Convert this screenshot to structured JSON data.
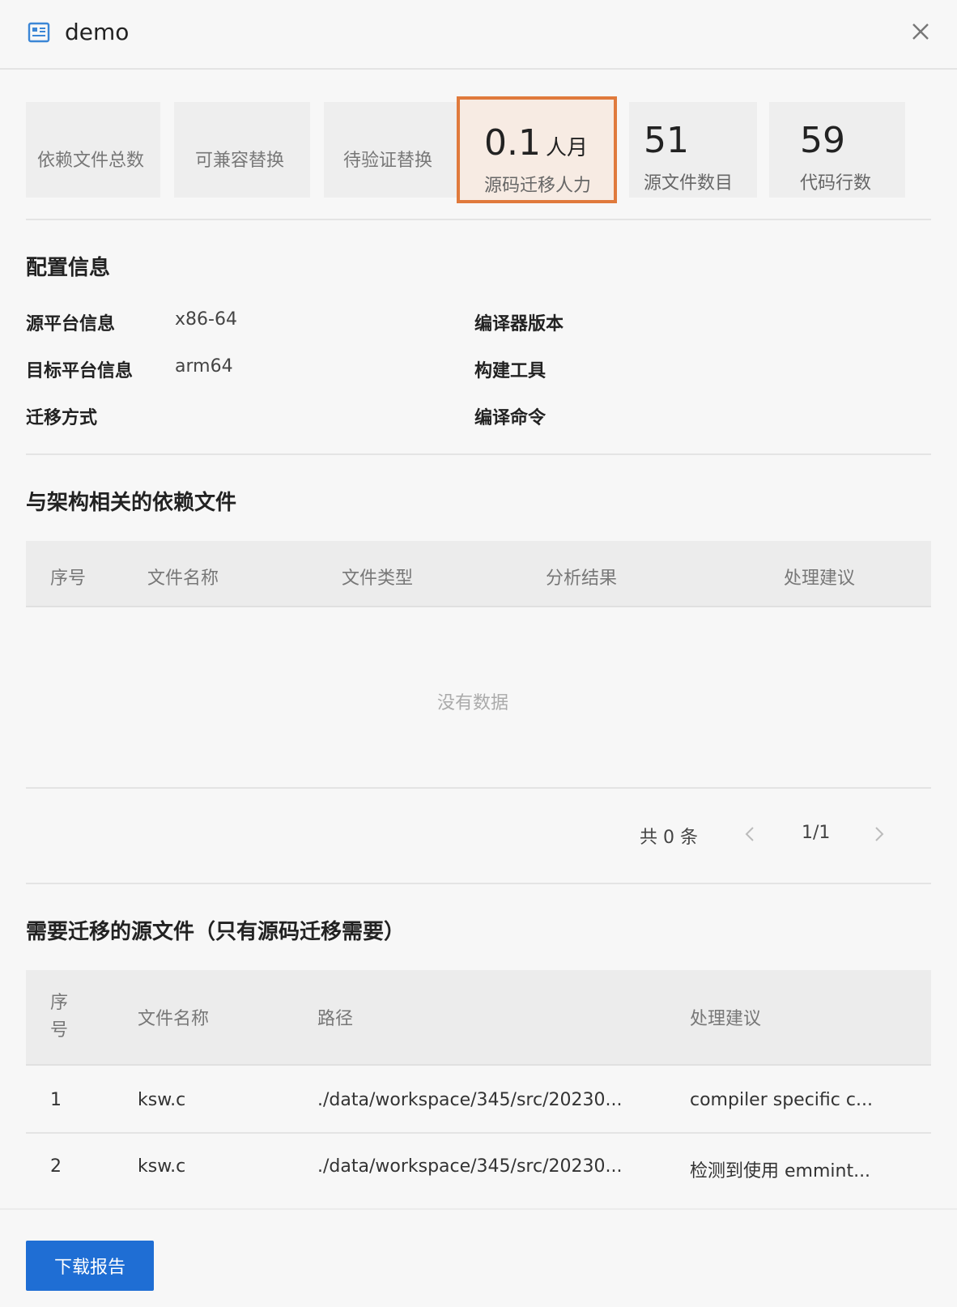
{
  "header": {
    "title": "demo"
  },
  "cards": {
    "dep_total": "依赖文件总数",
    "compatible": "可兼容替换",
    "pending": "待验证替换",
    "effort": {
      "value": "0.1",
      "unit": "人月",
      "label": "源码迁移人力"
    },
    "source_files": {
      "value": "51",
      "label": "源文件数目"
    },
    "code_lines": {
      "value": "59",
      "label": "代码行数"
    }
  },
  "config": {
    "title": "配置信息",
    "source_platform_label": "源平台信息",
    "source_platform_value": "x86-64",
    "target_platform_label": "目标平台信息",
    "target_platform_value": "arm64",
    "migration_mode_label": "迁移方式",
    "compiler_version_label": "编译器版本",
    "build_tool_label": "构建工具",
    "compile_cmd_label": "编译命令"
  },
  "deps": {
    "title": "与架构相关的依赖文件",
    "columns": [
      "序号",
      "文件名称",
      "文件类型",
      "分析结果",
      "处理建议"
    ],
    "empty_text": "没有数据",
    "pager": {
      "total": "共 0 条",
      "page": "1/1"
    }
  },
  "sources": {
    "title": "需要迁移的源文件（只有源码迁移需要）",
    "columns": [
      "序\n号",
      "文件名称",
      "路径",
      "处理建议"
    ],
    "col_index_top": "序",
    "col_index_bottom": "号",
    "rows": [
      {
        "index": "1",
        "name": "ksw.c",
        "path": "./data/workspace/345/src/20230...",
        "advice": "compiler specific c..."
      },
      {
        "index": "2",
        "name": "ksw.c",
        "path": "./data/workspace/345/src/20230...",
        "advice": "检测到使用 emmint..."
      }
    ]
  },
  "footer": {
    "download_label": "下载报告"
  },
  "colors": {
    "accent": "#1f6ed4",
    "highlight_border": "#e07a3c",
    "highlight_bg": "#f7ebe3"
  }
}
